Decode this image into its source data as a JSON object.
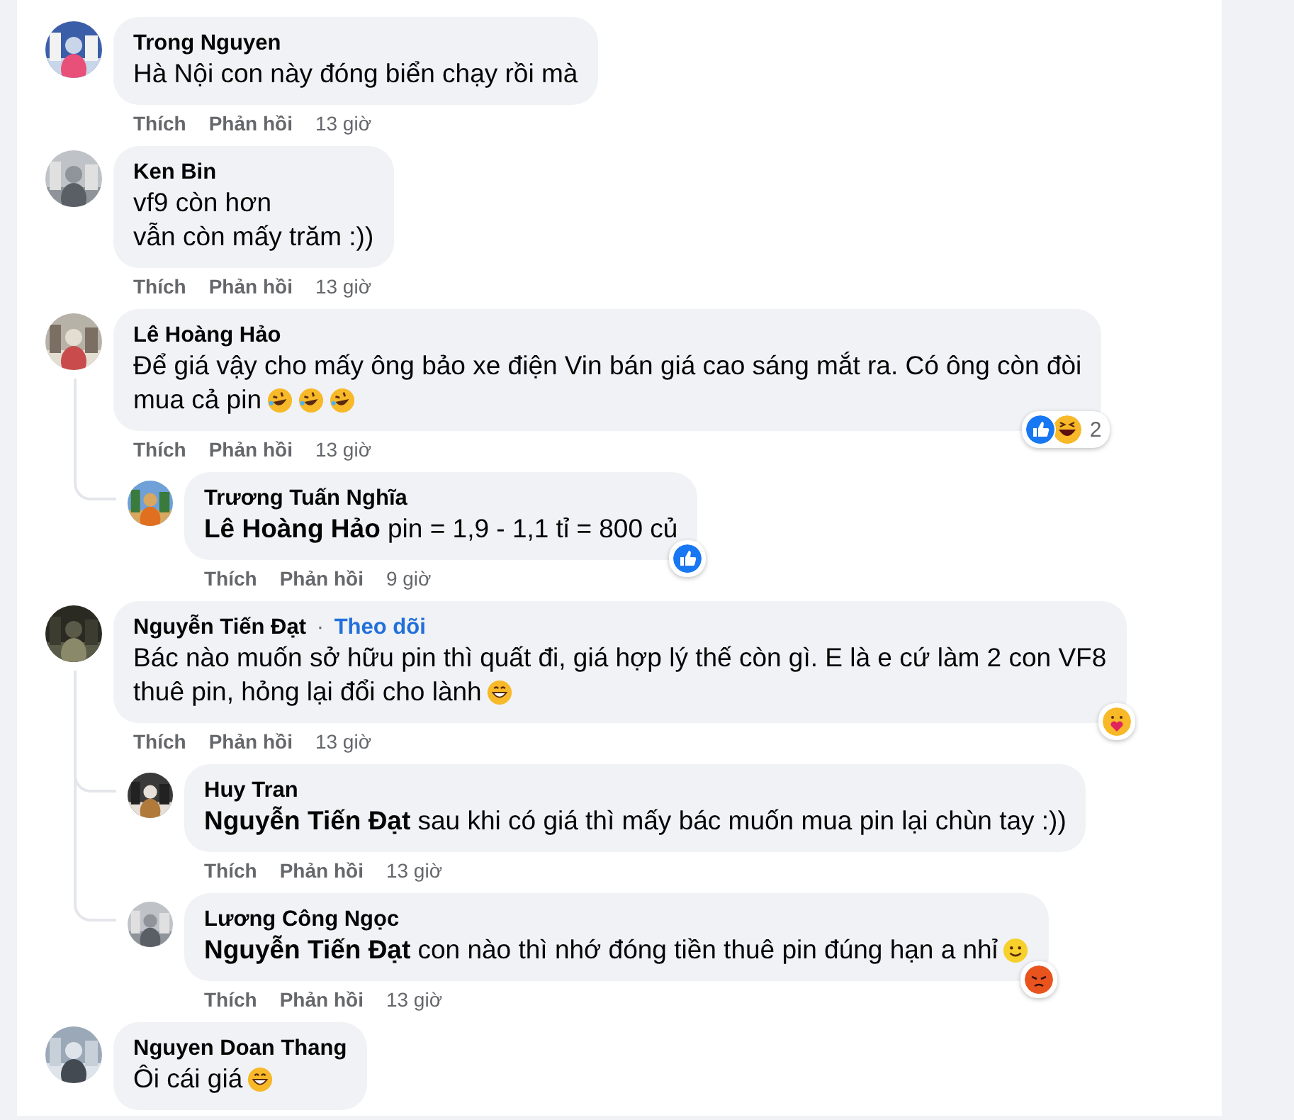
{
  "comments": [
    {
      "author": "Trong Nguyen",
      "lines": [
        "Hà Nội con này đóng biển chạy rồi mà"
      ],
      "actions": {
        "like": "Thích",
        "reply": "Phản hồi",
        "time": "13 giờ"
      }
    },
    {
      "author": "Ken Bin",
      "lines": [
        "vf9 còn hơn",
        "vẫn còn mấy trăm :))"
      ],
      "actions": {
        "like": "Thích",
        "reply": "Phản hồi",
        "time": "13 giờ"
      }
    },
    {
      "author": "Lê Hoàng Hảo",
      "lines": [
        "Để giá vậy cho mấy ông bảo xe điện Vin bán giá cao sáng mắt ra. Có ông còn đòi",
        "mua cả pin"
      ],
      "emojis": [
        {
          "kind": "rofl"
        },
        {
          "kind": "rofl"
        },
        {
          "kind": "rofl"
        }
      ],
      "reactions": {
        "kinds": [
          {
            "kind": "like"
          },
          {
            "kind": "haha"
          }
        ],
        "count": "2"
      },
      "actions": {
        "like": "Thích",
        "reply": "Phản hồi",
        "time": "13 giờ"
      },
      "children": [
        {
          "author": "Trương Tuấn Nghĩa",
          "lines": [
            "**Lê Hoàng Hảo** pin = 1,9 - 1,1 tỉ = 800 củ"
          ],
          "reactions": {
            "kinds": [
              {
                "kind": "like"
              }
            ]
          },
          "actions": {
            "like": "Thích",
            "reply": "Phản hồi",
            "time": "9 giờ"
          }
        }
      ]
    },
    {
      "author": "Nguyễn Tiến Đạt",
      "separator": "·",
      "follow": "Theo dõi",
      "lines": [
        "Bác nào muốn sở hữu pin thì quất đi, giá hợp lý thế còn gì. E là e cứ làm 2 con VF8",
        "thuê pin, hỏng lại đổi cho lành"
      ],
      "emojis": [
        {
          "kind": "grin"
        }
      ],
      "reactions": {
        "kinds": [
          {
            "kind": "care"
          }
        ]
      },
      "actions": {
        "like": "Thích",
        "reply": "Phản hồi",
        "time": "13 giờ"
      },
      "children": [
        {
          "author": "Huy Tran",
          "lines": [
            "**Nguyễn Tiến Đạt** sau khi có giá thì mấy bác muốn mua pin lại chùn tay :))"
          ],
          "actions": {
            "like": "Thích",
            "reply": "Phản hồi",
            "time": "13 giờ"
          }
        },
        {
          "author": "Lương Công Ngọc",
          "lines": [
            "**Nguyễn Tiến Đạt** con nào thì nhớ đóng tiền thuê pin đúng hạn a nhỉ"
          ],
          "emojis": [
            {
              "kind": "smile"
            }
          ],
          "reactions": {
            "kinds": [
              {
                "kind": "angry"
              }
            ]
          },
          "actions": {
            "like": "Thích",
            "reply": "Phản hồi",
            "time": "13 giờ"
          }
        }
      ]
    },
    {
      "author": "Nguyen Doan Thang",
      "lines": [
        "Ôi cái giá"
      ],
      "emojis": [
        {
          "kind": "grin"
        }
      ]
    }
  ]
}
